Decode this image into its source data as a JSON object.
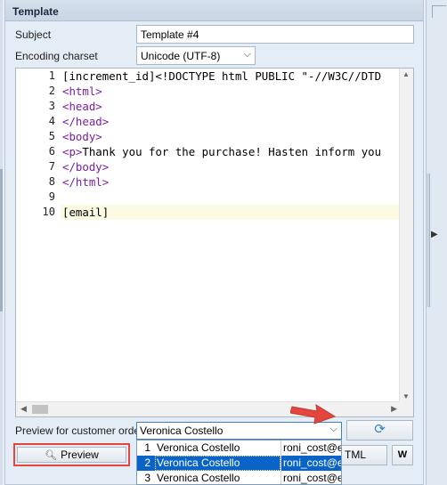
{
  "panel": {
    "title": "Template"
  },
  "form": {
    "subject_label": "Subject",
    "subject_value": "Template #4",
    "encoding_label": "Encoding charset",
    "encoding_value": "Unicode (UTF-8)",
    "order_label": "Preview for customer order",
    "order_value": "Veronica Costello"
  },
  "editor": {
    "lines": [
      {
        "no": "1",
        "text": "[increment_id]<!DOCTYPE html PUBLIC \"-//W3C//DTD"
      },
      {
        "no": "2",
        "text": "<html>"
      },
      {
        "no": "3",
        "text": "<head>"
      },
      {
        "no": "4",
        "text": "</head>"
      },
      {
        "no": "5",
        "text": "<body>"
      },
      {
        "no": "6",
        "text": "<p>Thank you for the purchase! Hasten inform you"
      },
      {
        "no": "7",
        "text": "</body>"
      },
      {
        "no": "8",
        "text": "</html>"
      },
      {
        "no": "9",
        "text": ""
      },
      {
        "no": "10",
        "text": "[email]"
      }
    ]
  },
  "buttons": {
    "preview": "Preview",
    "html": "TML",
    "wrap": "W"
  },
  "dropdown": {
    "rows": [
      {
        "num": "1",
        "name": "Veronica Costello",
        "email": "roni_cost@ex"
      },
      {
        "num": "2",
        "name": "Veronica Costello",
        "email": "roni_cost@ex"
      },
      {
        "num": "3",
        "name": "Veronica Costello",
        "email": "roni_cost@ex"
      }
    ],
    "selected_index": 1
  },
  "icons": {
    "refresh": "refresh-icon",
    "preview": "magnifier-icon",
    "wrap": "word-wrap-icon",
    "annotation": "red-arrow"
  },
  "colors": {
    "highlight_red": "#e2463d",
    "selection_blue": "#0a64c8",
    "tag_purple": "#7a1ea1"
  }
}
